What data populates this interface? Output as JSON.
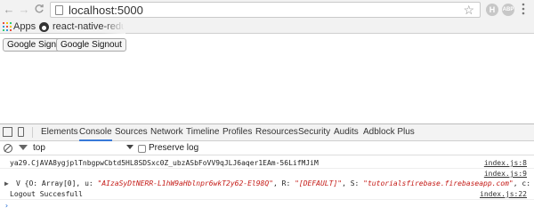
{
  "browser": {
    "url": "localhost:5000",
    "bookmarks": [
      {
        "label": "Apps"
      },
      {
        "label": "react-native-redux-f"
      }
    ],
    "ext_h": "H",
    "ext_abp": "ABP",
    "nav_back": "←",
    "nav_forward": "→",
    "nav_reload": "C",
    "star": "☆",
    "menu": "⋮"
  },
  "page": {
    "signin_label": "Google Signin",
    "signout_label": "Google Signout"
  },
  "devtools": {
    "tabs": [
      "Elements",
      "Console",
      "Sources",
      "Network",
      "Timeline",
      "Profiles",
      "Resources",
      "Security",
      "Audits",
      "Adblock Plus"
    ],
    "active_tab": "Console",
    "context": "top",
    "preserve_log_label": "Preserve log",
    "console": {
      "line1_text": "ya29.CjAVA8ygjplTnbgpwCbtd5HL8SDSxc0Z_ubzASbFoVV9qJLJ6aqer1EAm-56LifMJiM",
      "line1_src": "index.js:8",
      "line2_src": "index.js:9",
      "obj_arrow": "▶",
      "obj_prefix": "V {O: Array[0], u: ",
      "obj_u": "\"AIzaSyDtNERR-L1hW9aHblnpr6wkT2y62-El98Q\"",
      "obj_mid": ", R: ",
      "obj_r": "\"[DEFAULT]\"",
      "obj_mid2": ", S: ",
      "obj_s": "\"tutorialsfirebase.firebaseapp.com\"",
      "obj_suffix": ", c: S…}",
      "line3_text": "Logout Succesfull",
      "line3_src": "index.js:22",
      "prompt": "›"
    }
  },
  "colors": {
    "accent": "#3879d9",
    "string": "#c41a16"
  }
}
